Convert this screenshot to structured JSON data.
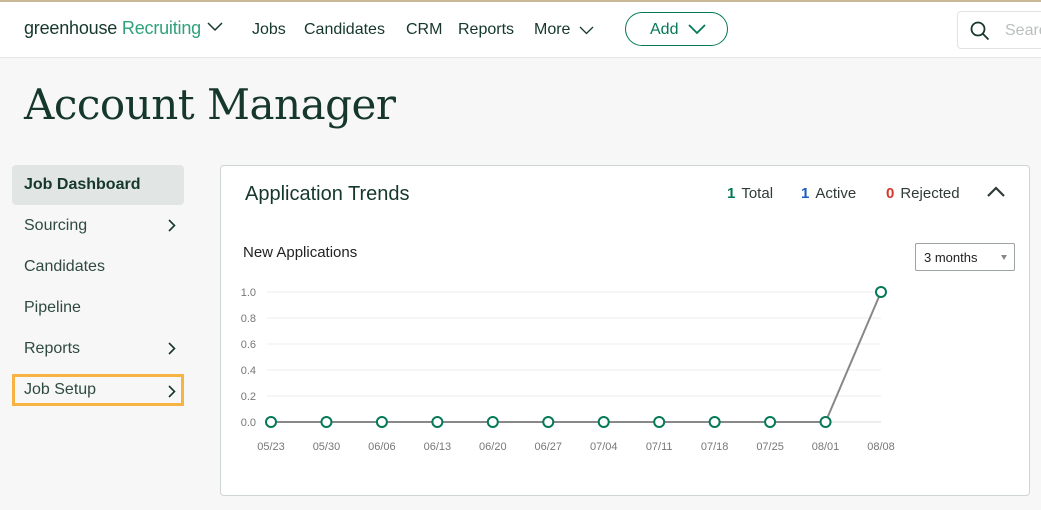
{
  "nav": {
    "logo_main": "greenhouse",
    "logo_sub": "Recruiting",
    "items": [
      "Jobs",
      "Candidates",
      "CRM",
      "Reports",
      "More"
    ],
    "add_label": "Add",
    "search_placeholder": "Search"
  },
  "page": {
    "title": "Account Manager"
  },
  "sidebar": {
    "items": [
      {
        "label": "Job Dashboard",
        "state": "active",
        "has_chevron": false
      },
      {
        "label": "Sourcing",
        "has_chevron": true
      },
      {
        "label": "Candidates",
        "has_chevron": false
      },
      {
        "label": "Pipeline",
        "has_chevron": false
      },
      {
        "label": "Reports",
        "has_chevron": true
      },
      {
        "label": "Job Setup",
        "state": "highlighted",
        "has_chevron": true
      }
    ]
  },
  "card": {
    "title": "Application Trends",
    "stats": [
      {
        "value": "1",
        "label": "Total",
        "color": "#047957"
      },
      {
        "value": "1",
        "label": "Active",
        "color": "#1d5bbf"
      },
      {
        "value": "0",
        "label": "Rejected",
        "color": "#d8362b"
      }
    ],
    "subtitle": "New Applications",
    "range_value": "3 months"
  },
  "colors": {
    "brand": "#047957",
    "highlight": "#f7b442"
  },
  "chart_data": {
    "type": "line",
    "title": "New Applications",
    "xlabel": "",
    "ylabel": "",
    "categories": [
      "05/23",
      "05/30",
      "06/06",
      "06/13",
      "06/20",
      "06/27",
      "07/04",
      "07/11",
      "07/18",
      "07/25",
      "08/01",
      "08/08"
    ],
    "series": [
      {
        "name": "New Applications",
        "values": [
          0,
          0,
          0,
          0,
          0,
          0,
          0,
          0,
          0,
          0,
          0,
          1
        ]
      }
    ],
    "yticks": [
      "0.0",
      "0.2",
      "0.4",
      "0.6",
      "0.8",
      "1.0"
    ],
    "ylim": [
      0,
      1
    ],
    "grid": true,
    "line_color": "#888888",
    "marker_color": "#047957"
  }
}
